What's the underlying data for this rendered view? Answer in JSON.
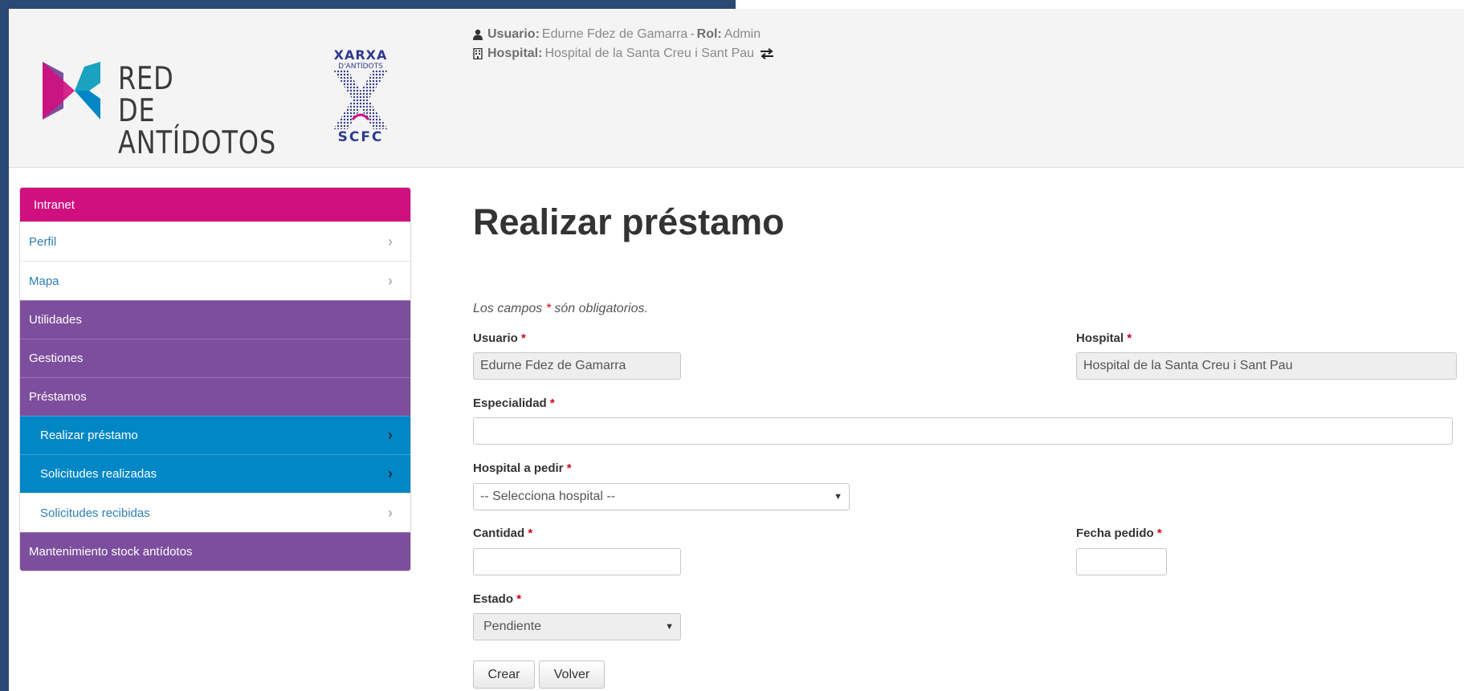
{
  "brand": {
    "logo_main_line1": "RED",
    "logo_main_line2": "DE ANTÍDOTOS",
    "logo_secondary_top": "XARXA",
    "logo_secondary_sub": "D'ANTÍDOTS",
    "logo_secondary_bottom": "SCFC"
  },
  "header": {
    "user_label": "Usuario:",
    "user_value": "Edurne Fdez de Gamarra",
    "separator": "-",
    "role_label": "Rol:",
    "role_value": "Admin",
    "hospital_label": "Hospital:",
    "hospital_value": "Hospital de la Santa Creu i Sant Pau"
  },
  "sidebar": {
    "header": "Intranet",
    "items": [
      {
        "label": "Perfil"
      },
      {
        "label": "Mapa"
      },
      {
        "label": "Utilidades"
      },
      {
        "label": "Gestiones"
      },
      {
        "label": "Préstamos"
      },
      {
        "label": "Realizar préstamo"
      },
      {
        "label": "Solicitudes realizadas"
      },
      {
        "label": "Solicitudes recibidas"
      },
      {
        "label": "Mantenimiento stock antídotos"
      }
    ]
  },
  "form": {
    "title": "Realizar préstamo",
    "required_note_prefix": "Los campos ",
    "required_note_star": "*",
    "required_note_suffix": " són obligatorios.",
    "required_marker": "*",
    "usuario_label": "Usuario",
    "usuario_value": "Edurne Fdez de Gamarra",
    "hospital_label": "Hospital",
    "hospital_value": "Hospital de la Santa Creu i Sant Pau",
    "especialidad_label": "Especialidad",
    "especialidad_value": "",
    "hospital_pedir_label": "Hospital a pedir",
    "hospital_pedir_value": "-- Selecciona hospital --",
    "cantidad_label": "Cantidad",
    "cantidad_value": "",
    "fecha_label": "Fecha pedido",
    "fecha_value": "",
    "estado_label": "Estado",
    "estado_value": "Pendiente",
    "crear_button": "Crear",
    "volver_button": "Volver"
  },
  "colors": {
    "frame": "#2a4a75",
    "sidebar_head": "#d0107f",
    "sidebar_purple": "#7d4e9d",
    "sidebar_blue": "#0186c6",
    "required": "#d0021b"
  }
}
